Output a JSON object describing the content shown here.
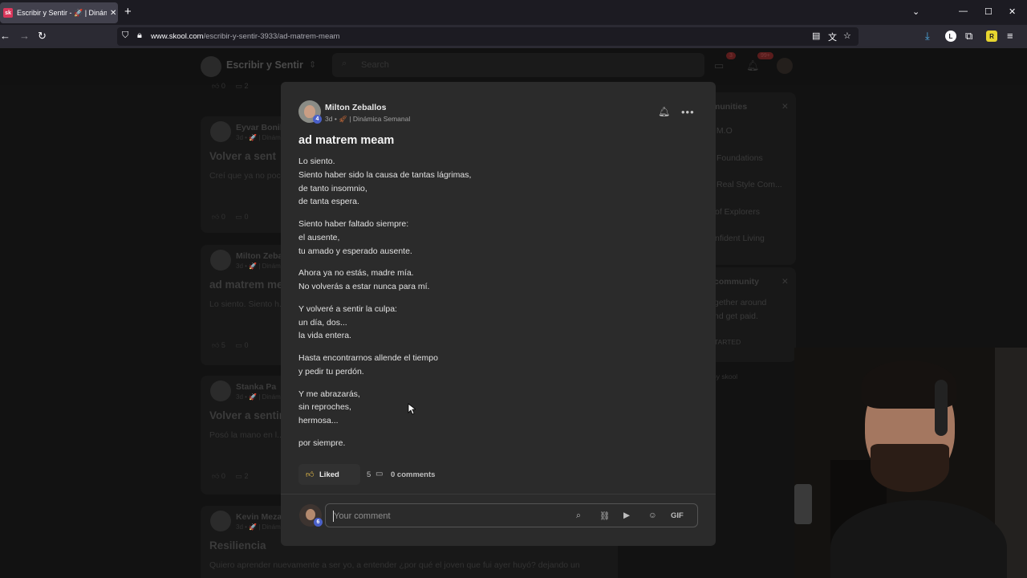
{
  "browser": {
    "tab_title": "Escribir y Sentir - 🚀 | Dinámica",
    "tab_favicon": "sk",
    "url_domain": "www.skool.com",
    "url_path": "/escribir-y-sentir-3933/ad-matrem-meam"
  },
  "background": {
    "group_name": "Escribir y Sentir",
    "search_placeholder": "Search",
    "chat_badge": "3",
    "notif_badge": "99+",
    "feed": [
      {
        "author": "Eyvar Bonill",
        "meta": "3d • 🚀 | Dinám",
        "title": "Volver a sent",
        "body": "Creí que ya no poc... silencio, a los días",
        "likes": "0",
        "comments": "0"
      },
      {
        "author": "Milton Zeba",
        "meta": "3d • 🚀 | Dinám",
        "title": "ad matrem me",
        "body": "Lo siento. Siento h... haber faltado siem",
        "likes": "5",
        "comments": "0"
      },
      {
        "author": "Stanka Pa",
        "meta": "3d • 🚀 | Dinám",
        "title": "Volver a sentir",
        "body": "Posó la mano en l... inútil intento por fi",
        "likes": "0",
        "comments": "2"
      },
      {
        "author": "Kevin Meza",
        "meta": "3d • 🚀 | Dinám",
        "title": "Resiliencia",
        "body": "Quiero aprender nuevamente a ser yo, a entender ¿por qué el joven que fui ayer huyó? dejando un",
        "likes": "",
        "comments": ""
      }
    ],
    "top_stats": {
      "likes": "0",
      "comments": "2"
    },
    "side_communities_header": "munities",
    "side_communities": [
      ".M.O",
      "Foundations",
      "Real Style Com...",
      "of Explorers",
      "nfident Living"
    ],
    "side_promo_header": "community",
    "side_promo_text": [
      "gether around",
      "nd get paid."
    ],
    "side_promo_cta": "TARTED",
    "powered_by": "by skool"
  },
  "post": {
    "author": "Milton Zeballos",
    "author_level": "4",
    "time": "3d",
    "category": "| Dinámica Semanal",
    "title": "ad matrem meam",
    "stanzas": [
      [
        "Lo siento.",
        "Siento haber sido la causa de tantas lágrimas,",
        "de tanto insomnio,",
        "de tanta espera."
      ],
      [
        "Siento haber faltado siempre:",
        "el ausente,",
        "tu amado y esperado ausente."
      ],
      [
        "Ahora ya no estás, madre mía.",
        "No volverás a estar nunca para mí."
      ],
      [
        "Y volveré a sentir la culpa:",
        "un día, dos...",
        "la vida entera."
      ],
      [
        "Hasta encontrarnos allende el tiempo",
        "y pedir tu perdón."
      ],
      [
        "Y me abrazarás,",
        "sin reproches,",
        "hermosa..."
      ],
      [
        "por siempre."
      ]
    ],
    "liked_label": "Liked",
    "likes": "5",
    "comments_label": "0 comments",
    "comment_placeholder": "Your comment",
    "commenter_level": "6",
    "gif_label": "GIF"
  },
  "colors": {
    "like_icon": "#f0c44a",
    "level_badge": "#4a60c8",
    "favicon": "#d9365a"
  }
}
